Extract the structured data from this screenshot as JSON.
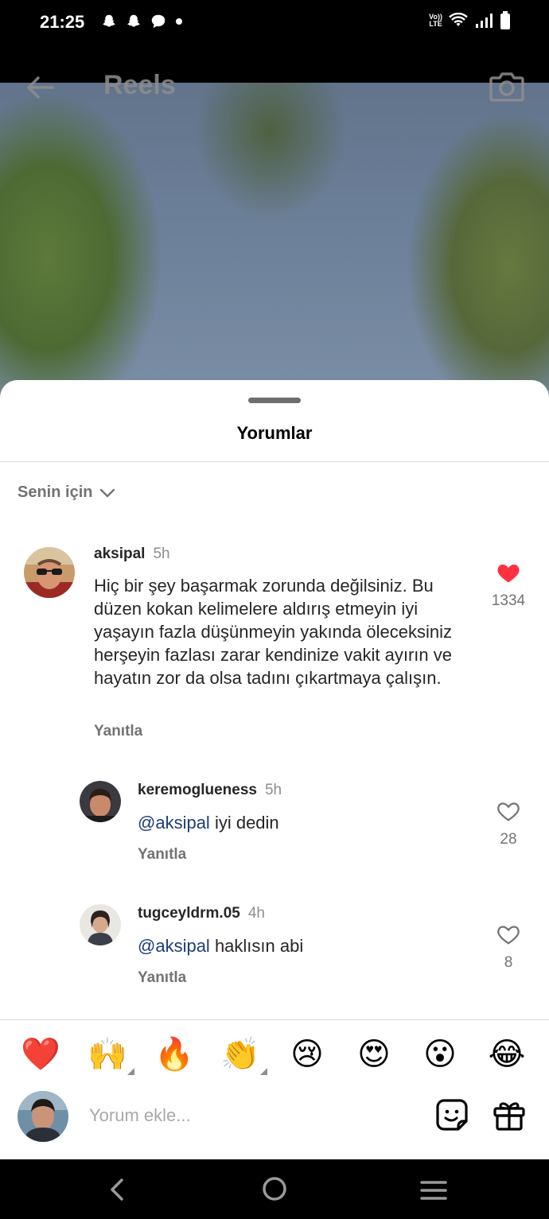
{
  "status_bar": {
    "time": "21:25",
    "notifications": [
      "snapchat-icon",
      "snapchat-icon",
      "chat-bubble-icon",
      "dot-icon"
    ],
    "volte": [
      "Vo))",
      "LTE"
    ]
  },
  "reel": {
    "title": "Reels"
  },
  "sheet": {
    "title": "Yorumlar",
    "filter_label": "Senin için"
  },
  "comments": [
    {
      "username": "aksipal",
      "time": "5h",
      "text": "Hiç bir şey başarmak zorunda değilsiniz. Bu düzen kokan kelimelere aldırış etmeyin iyi yaşayın fazla düşünmeyin yakında öleceksiniz herşeyin fazlası zarar kendinize vakit ayırın ve hayatın zor da olsa tadını çıkartmaya çalışın.",
      "reply_label": "Yanıtla",
      "likes": "1334",
      "liked": true
    },
    {
      "username": "keremoglueness",
      "time": "5h",
      "mention": "@aksipal",
      "text": " iyi dedin",
      "reply_label": "Yanıtla",
      "likes": "28",
      "liked": false
    },
    {
      "username": "tugceyldrm.05",
      "time": "4h",
      "mention": "@aksipal",
      "text": " haklısın abi",
      "reply_label": "Yanıtla",
      "likes": "8",
      "liked": false
    }
  ],
  "emojis": [
    "❤️",
    "🙌",
    "🔥",
    "👏",
    "😢",
    "😍",
    "😮",
    "😂"
  ],
  "composer": {
    "placeholder": "Yorum ekle..."
  },
  "colors": {
    "like_red": "#ff3040",
    "mention_blue": "#1c3d7a",
    "muted_gray": "#737373"
  }
}
